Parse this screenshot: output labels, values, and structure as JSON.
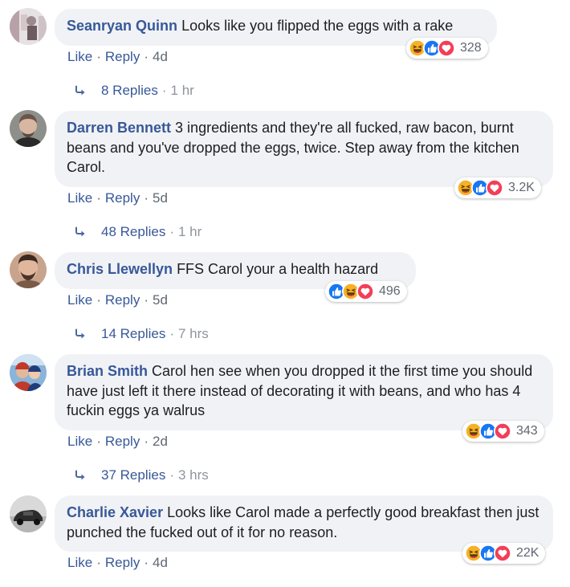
{
  "comments": [
    {
      "author": "Seanryan Quinn",
      "text": "Looks like you flipped the eggs with a rake",
      "like_label": "Like",
      "reply_label": "Reply",
      "age": "4d",
      "reaction_count": "328",
      "reactions": [
        "haha-icon",
        "like-icon",
        "love-icon"
      ],
      "replies_label": "8 Replies",
      "replies_time": "1 hr"
    },
    {
      "author": "Darren Bennett",
      "text": "3 ingredients and they're all fucked, raw bacon, burnt beans and you've dropped the eggs, twice. Step away from the kitchen Carol.",
      "like_label": "Like",
      "reply_label": "Reply",
      "age": "5d",
      "reaction_count": "3.2K",
      "reactions": [
        "haha-icon",
        "like-icon",
        "love-icon"
      ],
      "replies_label": "48 Replies",
      "replies_time": "1 hr"
    },
    {
      "author": "Chris Llewellyn",
      "text": "FFS Carol your a health hazard",
      "like_label": "Like",
      "reply_label": "Reply",
      "age": "5d",
      "reaction_count": "496",
      "reactions": [
        "like-icon",
        "haha-icon",
        "love-icon"
      ],
      "replies_label": "14 Replies",
      "replies_time": "7 hrs"
    },
    {
      "author": "Brian Smith",
      "text": "Carol hen see when you dropped it the first time you should have just left it there instead of decorating it with beans, and who has 4 fuckin eggs ya walrus",
      "like_label": "Like",
      "reply_label": "Reply",
      "age": "2d",
      "reaction_count": "343",
      "reactions": [
        "haha-icon",
        "like-icon",
        "love-icon"
      ],
      "replies_label": "37 Replies",
      "replies_time": "3 hrs"
    },
    {
      "author": "Charlie Xavier",
      "text": "Looks like Carol made a perfectly good breakfast then just punched the fucked out of it for no reason.",
      "like_label": "Like",
      "reply_label": "Reply",
      "age": "4d",
      "reaction_count": "22K",
      "reactions": [
        "haha-icon",
        "like-icon",
        "love-icon"
      ]
    }
  ],
  "colors": {
    "link": "#385898",
    "bubble": "#f0f2f5",
    "meta": "#606770",
    "like": "#1877f2",
    "love": "#f33e58",
    "haha": "#f7b125"
  }
}
